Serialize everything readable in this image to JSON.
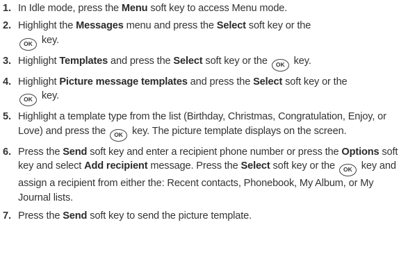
{
  "steps": [
    {
      "number": "1.",
      "t1": "In Idle mode, press the ",
      "b1": "Menu",
      "t2": " soft key to access Menu mode."
    },
    {
      "number": "2.",
      "t1": "Highlight the ",
      "b1": "Messages",
      "t2": " menu and press the ",
      "b2": "Select",
      "t3": " soft key or the",
      "key": "OK",
      "t4": " key."
    },
    {
      "number": "3.",
      "t1": "Highlight ",
      "b1": "Templates",
      "t2": " and press the ",
      "b2": "Select",
      "t3": " soft key or the ",
      "key": "OK",
      "t4": " key."
    },
    {
      "number": "4.",
      "t1": "Highlight ",
      "b1": "Picture message templates",
      "t2": " and press the ",
      "b2": "Select",
      "t3": " soft key or the",
      "key": "OK",
      "t4": " key."
    },
    {
      "number": "5.",
      "t1": "Highlight a template type from the list (Birthday, Christmas, Congratulation, Enjoy, or Love) and press the ",
      "key": "OK",
      "t2": " key. The picture template displays on the screen."
    },
    {
      "number": "6.",
      "t1": "Press the ",
      "b1": "Send",
      "t2": " soft key and enter a recipient phone number or press the ",
      "b2": "Options",
      "t3": " soft key and select ",
      "b3": "Add recipient",
      "t4": " message. Press the ",
      "b4": "Select",
      "t5": " soft key or the ",
      "key": "OK",
      "t6": " key and assign a recipient from either the: Recent contacts, Phonebook, My Album, or My Journal lists."
    },
    {
      "number": "7.",
      "t1": "Press the ",
      "b1": "Send",
      "t2": " soft key to send the picture template."
    }
  ]
}
